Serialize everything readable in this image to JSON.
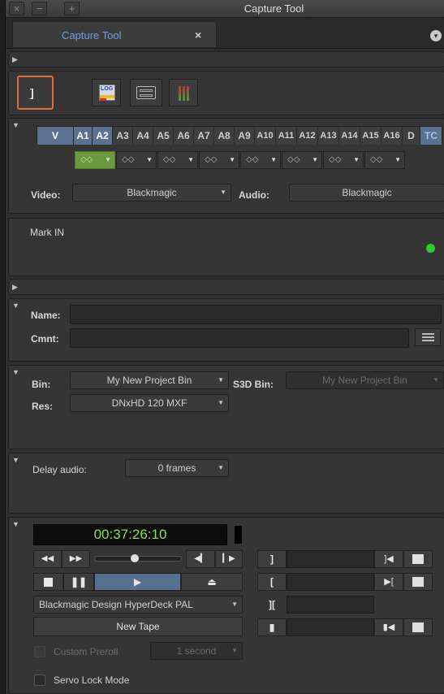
{
  "window": {
    "title": "Capture Tool",
    "close_glyph": "×",
    "minimize_glyph": "−",
    "zoom_glyph": "+"
  },
  "tab": {
    "label": "Capture Tool",
    "close_glyph": "×",
    "menu_glyph": "▾"
  },
  "toolbar": {
    "log_icon": "LOG",
    "mode_icons": [
      "capture-mode-icon",
      "log-mode-icon",
      "deck-icon",
      "audio-meter-icon"
    ]
  },
  "tracks": {
    "buttons": [
      "V",
      "A1",
      "A2",
      "A3",
      "A4",
      "A5",
      "A6",
      "A7",
      "A8",
      "A9",
      "A10",
      "A11",
      "A12",
      "A13",
      "A14",
      "A15",
      "A16",
      "D",
      "TC"
    ],
    "active": [
      "V",
      "A1",
      "A2",
      "TC"
    ],
    "monitor_glyph": "◇◇"
  },
  "io": {
    "video_label": "Video:",
    "video_value": "Blackmagic",
    "audio_label": "Audio:",
    "audio_value": "Blackmagic"
  },
  "status": {
    "text": "Mark IN",
    "indicator_color": "#2ecc2e"
  },
  "clip": {
    "name_label": "Name:",
    "name_value": "",
    "comment_label": "Cmnt:",
    "comment_value": ""
  },
  "bins": {
    "bin_label": "Bin:",
    "bin_value": "My New Project Bin",
    "s3d_label": "S3D Bin:",
    "s3d_value": "My New Project Bin",
    "res_label": "Res:",
    "res_value": "DNxHD 120  MXF"
  },
  "delay": {
    "label": "Delay audio:",
    "value": "0 frames"
  },
  "deck": {
    "timecode": "00:37:26:10",
    "deck_name": "Blackmagic Design HyperDeck PAL",
    "tape_button": "New Tape",
    "preroll_label": "Custom Preroll",
    "preroll_value": "1 second",
    "servo_label": "Servo Lock Mode"
  },
  "colors": {
    "accent": "#6fa0e0",
    "selected": "#56708f",
    "timecode": "#8ee04a",
    "record_outline": "#e07030"
  }
}
